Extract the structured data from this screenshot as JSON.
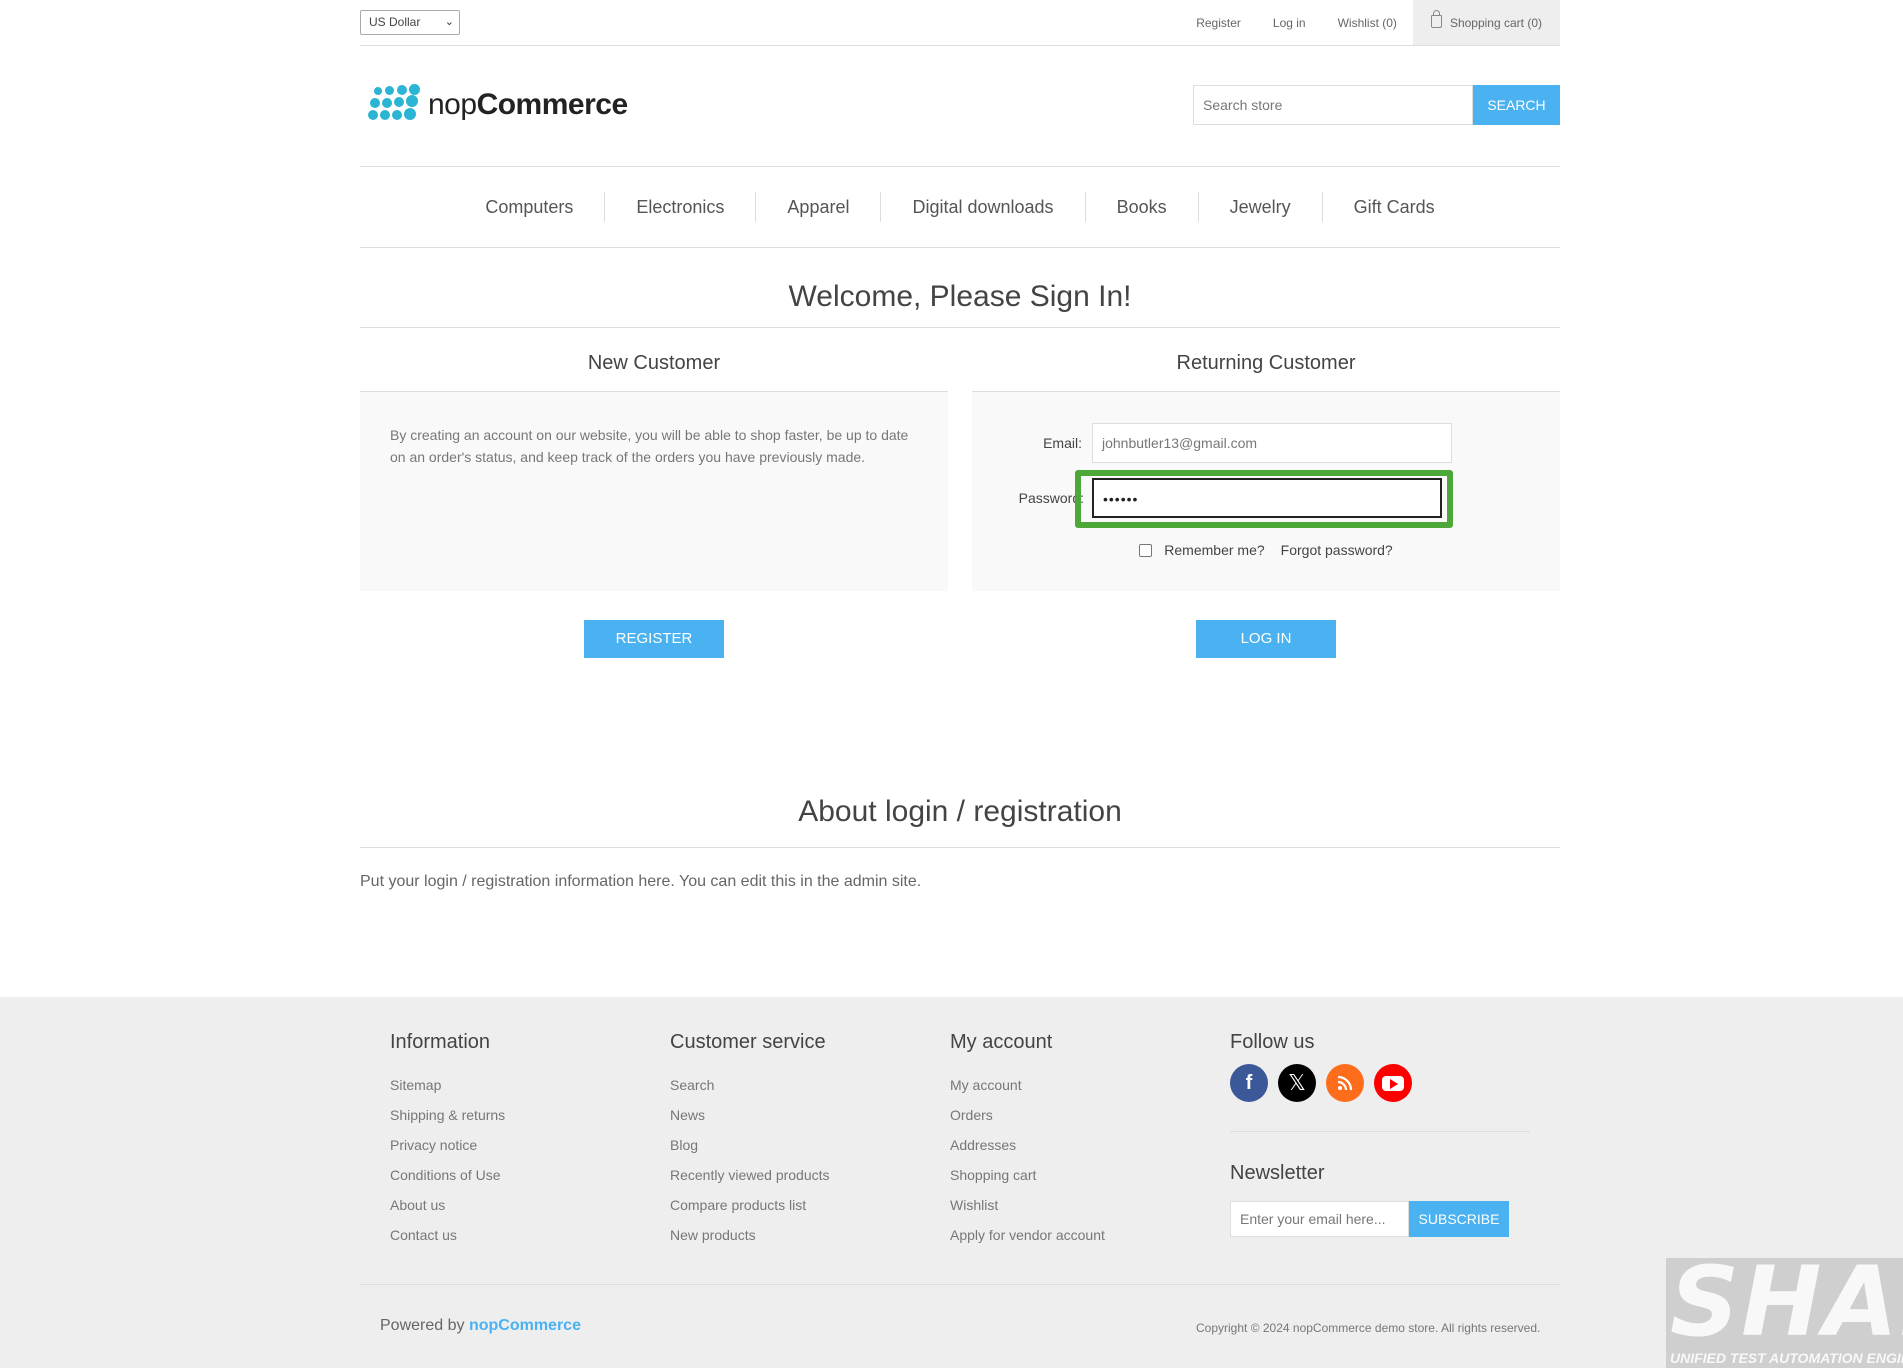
{
  "header": {
    "currency": "US Dollar",
    "register": "Register",
    "login": "Log in",
    "wishlist": "Wishlist (0)",
    "cart": "Shopping cart (0)"
  },
  "logo": {
    "light": "nop",
    "bold": "Commerce"
  },
  "search": {
    "placeholder": "Search store",
    "button": "Search"
  },
  "menu": [
    "Computers",
    "Electronics",
    "Apparel",
    "Digital downloads",
    "Books",
    "Jewelry",
    "Gift Cards"
  ],
  "page_title": "Welcome, Please Sign In!",
  "new_customer": {
    "title": "New Customer",
    "text": "By creating an account on our website, you will be able to shop faster, be up to date on an order's status, and keep track of the orders you have previously made.",
    "button": "Register"
  },
  "returning_customer": {
    "title": "Returning Customer",
    "email_label": "Email:",
    "email_value": "johnbutler13@gmail.com",
    "password_label": "Password:",
    "password_value": "••••••",
    "remember": "Remember me?",
    "forgot": "Forgot password?",
    "button": "Log in"
  },
  "about": {
    "title": "About login / registration",
    "text": "Put your login / registration information here. You can edit this in the admin site."
  },
  "footer": {
    "information": {
      "title": "Information",
      "items": [
        "Sitemap",
        "Shipping & returns",
        "Privacy notice",
        "Conditions of Use",
        "About us",
        "Contact us"
      ]
    },
    "customer_service": {
      "title": "Customer service",
      "items": [
        "Search",
        "News",
        "Blog",
        "Recently viewed products",
        "Compare products list",
        "New products"
      ]
    },
    "my_account": {
      "title": "My account",
      "items": [
        "My account",
        "Orders",
        "Addresses",
        "Shopping cart",
        "Wishlist",
        "Apply for vendor account"
      ]
    },
    "follow_us": {
      "title": "Follow us",
      "icons": [
        "facebook-icon",
        "x-icon",
        "rss-icon",
        "youtube-icon"
      ]
    },
    "newsletter": {
      "title": "Newsletter",
      "placeholder": "Enter your email here...",
      "button": "Subscribe"
    },
    "powered_by": "Powered by",
    "powered_link": "nopCommerce",
    "copyright": "Copyright © 2024 nopCommerce demo store. All rights reserved."
  },
  "watermark": {
    "big": "SHAFT",
    "small": "UNIFIED TEST AUTOMATION ENGINE"
  },
  "colors": {
    "accent": "#4ab2f1",
    "highlight": "#4ca838",
    "logo": "#2bb4d4"
  }
}
